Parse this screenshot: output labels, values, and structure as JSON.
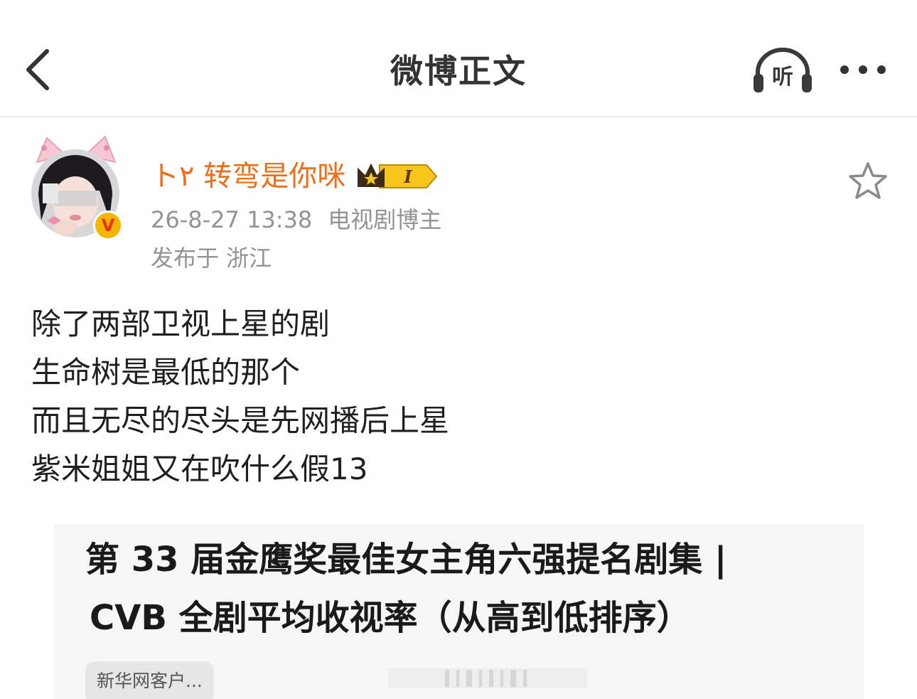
{
  "header": {
    "title": "微博正文",
    "listen_label": "听"
  },
  "author": {
    "name": "ト٢ 转弯是你咪",
    "member_level": "I",
    "verified_badge": "V",
    "timestamp": "26-8-27 13:38",
    "role": "电视剧博主",
    "location": "发布于 浙江"
  },
  "post": {
    "lines": [
      "除了两部卫视上星的剧",
      "生命树是最低的那个",
      "而且无尽的尽头是先网播后上星",
      "紫米姐姐又在吹什么假13"
    ]
  },
  "image_card": {
    "headline_1": "第 33 届金鹰奖最佳女主角六强提名剧集 |",
    "headline_2": "CVB 全剧平均收视率（从高到低排序）",
    "source": "新华网客户..."
  },
  "colors": {
    "accent_orange": "#f06d19",
    "meta_gray": "#939393",
    "verified_gold": "#f4b400"
  },
  "icons": {
    "back": "chevron-left-icon",
    "listen": "headphones-icon",
    "more": "more-dots-icon",
    "favorite": "star-outline-icon",
    "crown": "crown-icon"
  }
}
